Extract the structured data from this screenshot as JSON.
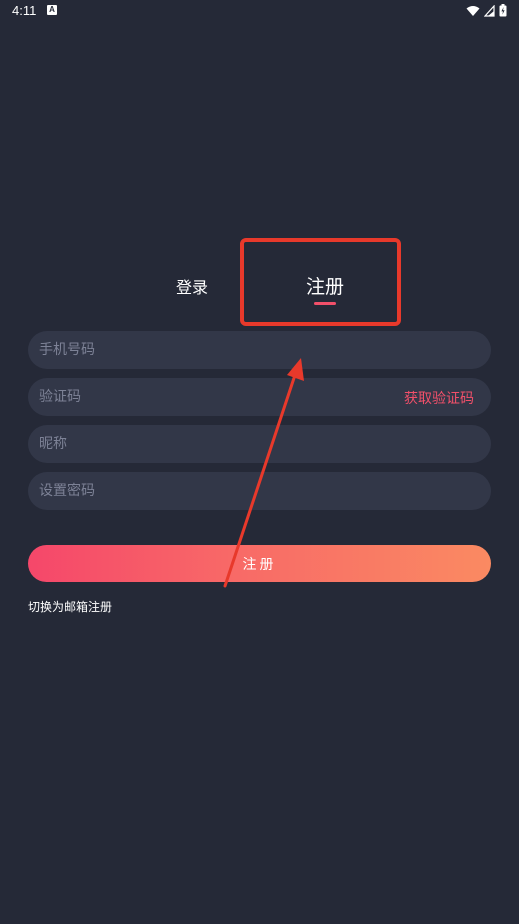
{
  "status_bar": {
    "time": "4:11",
    "notification_icon": "A",
    "icons": [
      "wifi-icon",
      "signal-icon",
      "battery-icon"
    ]
  },
  "tabs": {
    "login": "登录",
    "register": "注册",
    "active": "register"
  },
  "form": {
    "phone_placeholder": "手机号码",
    "code_placeholder": "验证码",
    "get_code_label": "获取验证码",
    "nickname_placeholder": "昵称",
    "password_placeholder": "设置密码"
  },
  "submit_label": "注册",
  "switch_label": "切换为邮箱注册",
  "colors": {
    "background": "#252937",
    "field": "#323748",
    "accent": "#f2506a",
    "annotation": "#e8392b"
  }
}
